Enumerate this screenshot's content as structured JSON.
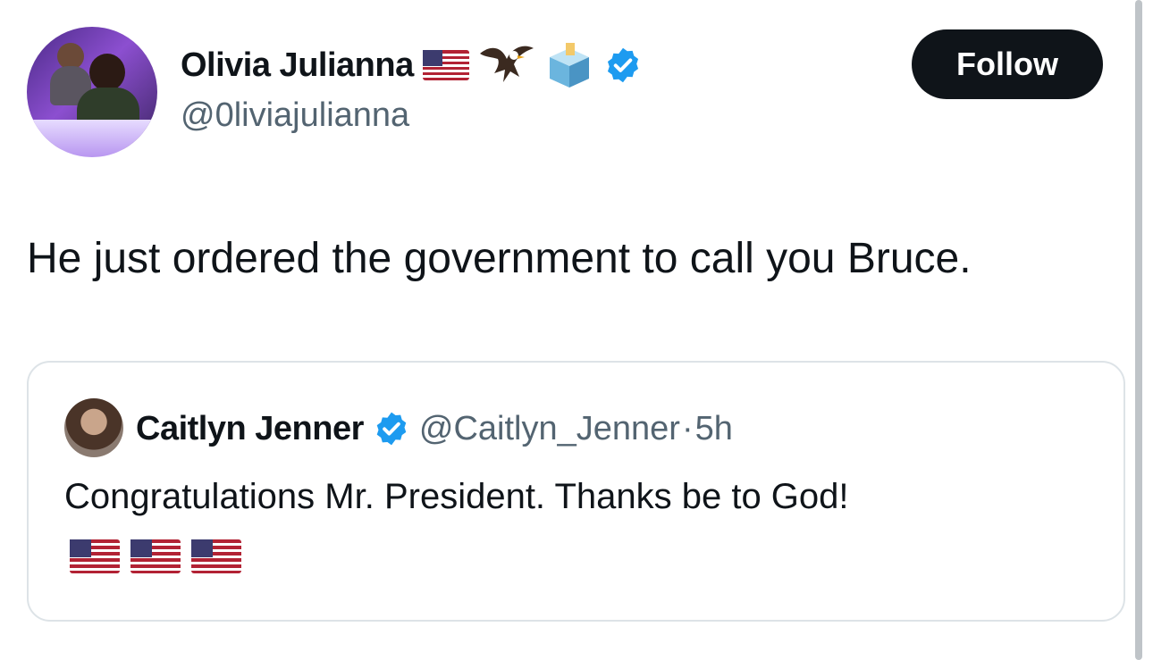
{
  "author": {
    "name": "Olivia Julianna",
    "handle": "@0liviajulianna",
    "name_emojis": [
      "us-flag-icon",
      "eagle-icon",
      "ballot-box-icon"
    ],
    "verified": true
  },
  "follow_button": {
    "label": "Follow"
  },
  "tweet": {
    "text": "He just ordered the government to call you Bruce."
  },
  "quoted_tweet": {
    "author_name": "Caitlyn Jenner",
    "verified": true,
    "handle": "@Caitlyn_Jenner",
    "separator": "·",
    "time": "5h",
    "text": "Congratulations Mr. President. Thanks be to God!",
    "emojis": [
      "us-flag-icon",
      "us-flag-icon",
      "us-flag-icon"
    ]
  },
  "colors": {
    "verified_blue": "#1d9bf0",
    "follow_bg": "#0f1419",
    "secondary_text": "#536471",
    "border": "#dde3e7"
  }
}
